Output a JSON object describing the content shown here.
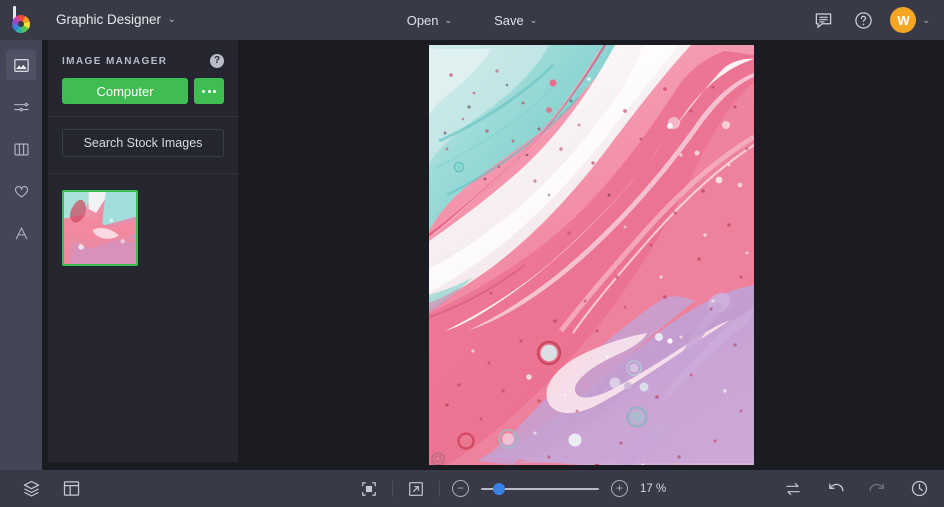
{
  "topbar": {
    "logo_name": "befunky-logo",
    "app_title": "Graphic Designer",
    "caret": "⌄",
    "open_label": "Open",
    "save_label": "Save",
    "feedback_icon": "chat-icon",
    "help_icon": "help-icon",
    "avatar_initial": "W",
    "avatar_color": "#f5a623"
  },
  "rail": {
    "items": [
      {
        "name": "image-manager",
        "icon": "image-icon",
        "active": true
      },
      {
        "name": "edit-adjust",
        "icon": "sliders-icon",
        "active": false
      },
      {
        "name": "templates",
        "icon": "columns-icon",
        "active": false
      },
      {
        "name": "graphics",
        "icon": "heart-icon",
        "active": false
      },
      {
        "name": "text",
        "icon": "text-a-icon",
        "active": false
      }
    ]
  },
  "panel": {
    "title": "IMAGE MANAGER",
    "help_icon": "help-icon",
    "help_glyph": "?",
    "computer_button": "Computer",
    "more_button_icon": "ellipsis-icon",
    "search_stock_button": "Search Stock Images",
    "thumbnails": [
      {
        "name": "image-thumbnail",
        "selected": true,
        "alt": "abstract pink teal fluid art"
      }
    ]
  },
  "canvas": {
    "artwork_name": "abstract-fluid-art",
    "description": "Abstract pink, teal, white and lavender fluid marble paint artwork"
  },
  "bottombar": {
    "layers_icon": "layers-icon",
    "layout_icon": "layout-icon",
    "fit_screen_icon": "fit-to-screen-icon",
    "fullscreen_icon": "expand-icon",
    "zoom_out_icon": "minus-icon",
    "zoom_out_glyph": "−",
    "zoom_in_icon": "plus-icon",
    "zoom_in_glyph": "+",
    "zoom_value": "17 %",
    "zoom_percent": 17,
    "compare_icon": "compare-swap-icon",
    "undo_icon": "undo-icon",
    "redo_icon": "redo-icon",
    "history_icon": "history-clock-icon"
  },
  "colors": {
    "topbar_bg": "#383b47",
    "rail_bg": "#434656",
    "panel_bg": "#25262f",
    "canvas_bg": "#1b1c21",
    "accent_green": "#3fbc52",
    "accent_blue": "#3b82e8",
    "avatar_orange": "#f5a623"
  }
}
